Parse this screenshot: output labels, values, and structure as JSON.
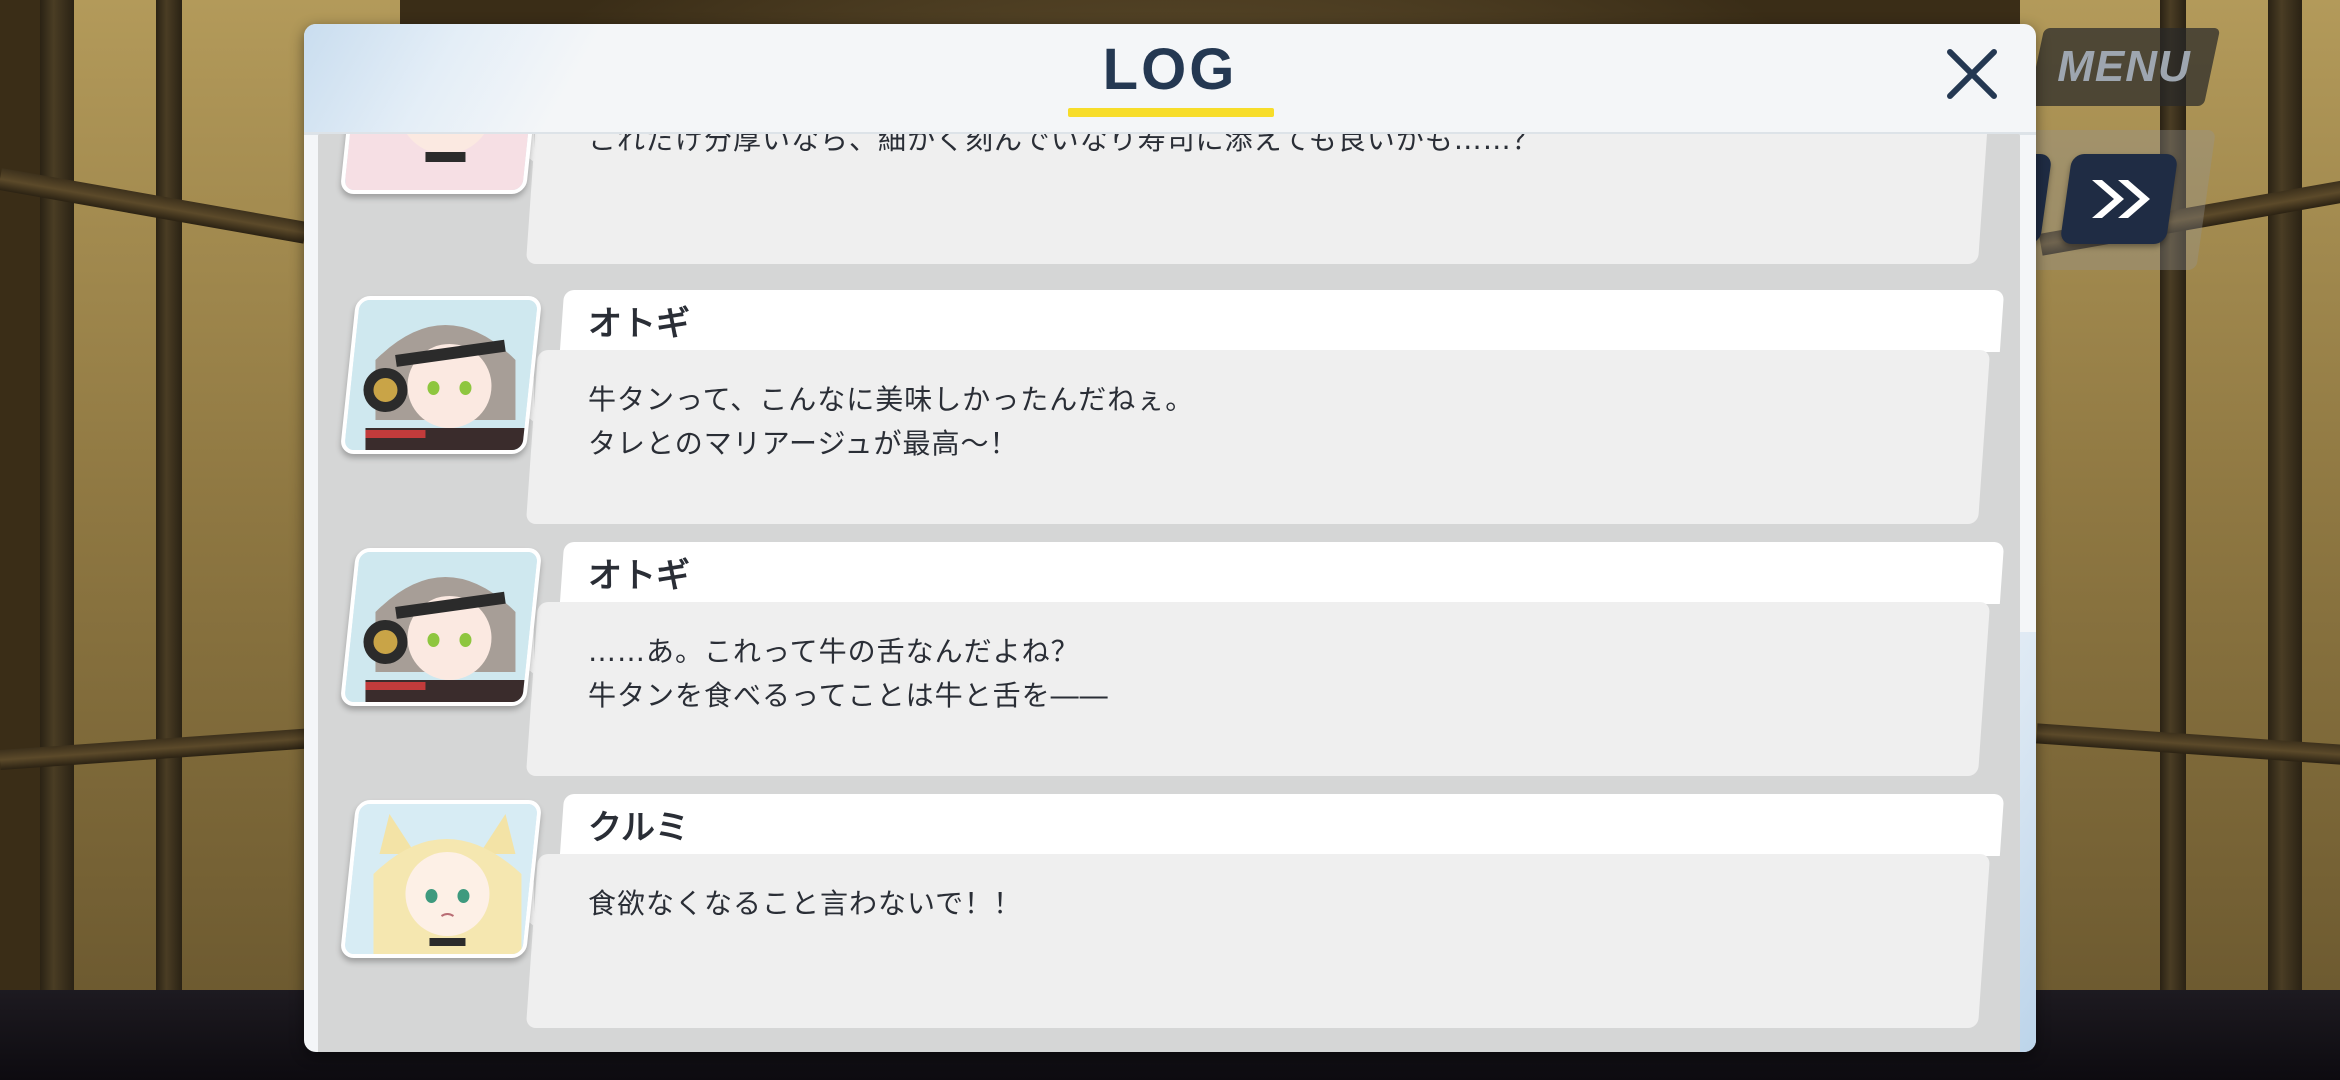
{
  "hud": {
    "menu_label": "MENU",
    "skip_icon": "fast-forward-icon",
    "prev_icon": "partial-button-icon"
  },
  "log": {
    "title": "LOG",
    "close_icon": "close-icon",
    "entries": [
      {
        "speaker": "",
        "lines": [
          "これだけ分厚いなら、細かく刻んでいなり寿司に添えても良いかも……？"
        ],
        "avatar": "pink-hair-character-avatar"
      },
      {
        "speaker": "オトギ",
        "lines": [
          "牛タンって、こんなに美味しかったんだねぇ。",
          "タレとのマリアージュが最高～！"
        ],
        "avatar": "otogi-avatar"
      },
      {
        "speaker": "オトギ",
        "lines": [
          "……あ。これって牛の舌なんだよね？",
          "牛タンを食べるってことは牛と舌を――"
        ],
        "avatar": "otogi-avatar"
      },
      {
        "speaker": "クルミ",
        "lines": [
          "食欲なくなること言わないで！！"
        ],
        "avatar": "kurumi-avatar"
      }
    ]
  },
  "colors": {
    "title": "#243852",
    "title_underline": "#f7dd2a",
    "button_dark": "#1f2c44"
  }
}
